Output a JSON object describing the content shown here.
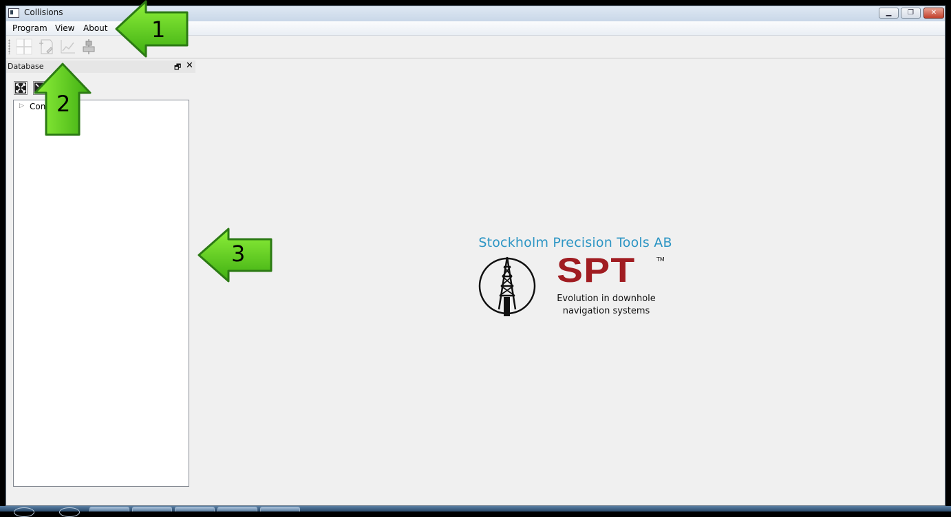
{
  "window": {
    "title": "Collisions",
    "controls": {
      "minimize": "▁",
      "maximize": "❐",
      "close": "✕"
    }
  },
  "menubar": {
    "items": [
      {
        "label": "Program"
      },
      {
        "label": "View"
      },
      {
        "label": "About"
      }
    ]
  },
  "toolbar": {
    "buttons": [
      {
        "icon": "crosshair-grid-icon"
      },
      {
        "icon": "add-document-icon"
      },
      {
        "icon": "line-chart-icon"
      },
      {
        "icon": "align-stack-icon"
      }
    ]
  },
  "dock": {
    "title": "Database",
    "float_glyph": "🗗",
    "close_glyph": "✕",
    "buttons": [
      {
        "icon": "expand-all-icon"
      },
      {
        "icon": "collapse-all-icon"
      }
    ],
    "tree": {
      "items": [
        {
          "label": "Cont",
          "expand_glyph": "▷"
        }
      ]
    }
  },
  "logo": {
    "company": "Stockholm Precision Tools AB",
    "brand": "SPT",
    "trademark": "TM",
    "tagline_line1": "Evolution in downhole",
    "tagline_line2": "navigation systems"
  },
  "annotations": [
    {
      "number": "1"
    },
    {
      "number": "2"
    },
    {
      "number": "3"
    }
  ],
  "colors": {
    "arrow_green": "#5fd01c",
    "arrow_border": "#2c7a14",
    "brand_red": "#a01c21",
    "company_blue": "#2c95c4"
  }
}
